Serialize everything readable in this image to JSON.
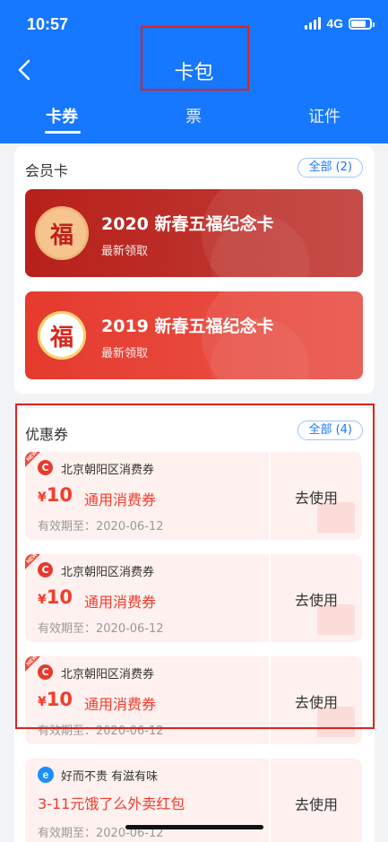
{
  "status_bar": {
    "time": "10:57",
    "network": "4G",
    "battery_percent": 80
  },
  "header": {
    "title": "卡包",
    "back_icon": "chevron-left-icon"
  },
  "tabs": [
    {
      "label": "卡券",
      "active": true
    },
    {
      "label": "票",
      "active": false
    },
    {
      "label": "证件",
      "active": false
    }
  ],
  "membership": {
    "title": "会员卡",
    "all_label": "全部 (2)",
    "cards": [
      {
        "name": "2020 新春五福纪念卡",
        "subtitle": "最新领取",
        "badge": "福",
        "color": "#b8201a"
      },
      {
        "name": "2019 新春五福纪念卡",
        "subtitle": "最新领取",
        "badge": "福",
        "color": "#e63a2e"
      }
    ]
  },
  "coupons": {
    "title": "优惠券",
    "all_label": "全部 (4)",
    "items": [
      {
        "ribbon": "NEW",
        "logo": "C",
        "brand": "北京朝阳区消费券",
        "currency": "¥",
        "amount": "10",
        "type": "通用消费券",
        "validity": "有效期至：2020-06-12",
        "action": "去使用"
      },
      {
        "ribbon": "NEW",
        "logo": "C",
        "brand": "北京朝阳区消费券",
        "currency": "¥",
        "amount": "10",
        "type": "通用消费券",
        "validity": "有效期至：2020-06-12",
        "action": "去使用"
      },
      {
        "ribbon": "NEW",
        "logo": "C",
        "brand": "北京朝阳区消费券",
        "currency": "¥",
        "amount": "10",
        "type": "通用消费券",
        "validity": "有效期至：2020-06-12",
        "action": "去使用"
      }
    ],
    "extra": {
      "logo": "e",
      "brand": "好而不贵 有滋有味",
      "title": "3-11元饿了么外卖红包",
      "validity": "有效期至：2020-06-12",
      "action": "去使用"
    }
  }
}
